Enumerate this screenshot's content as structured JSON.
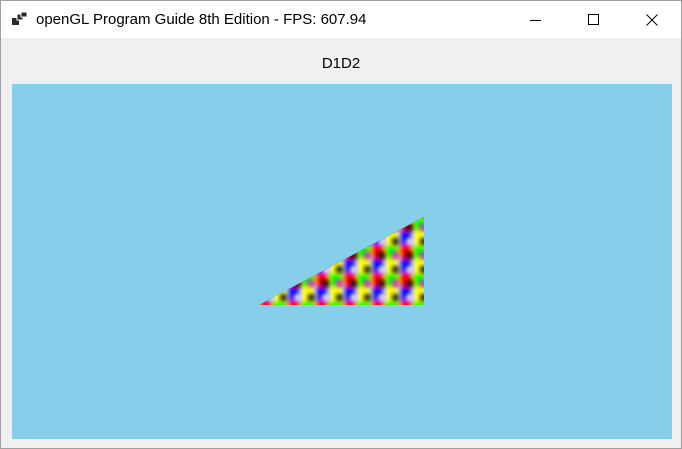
{
  "window": {
    "title": "openGL Program Guide 8th Edition - FPS: 607.94",
    "icon": "app-windows-icon",
    "controls": {
      "minimize_icon": "minimize-icon",
      "maximize_icon": "maximize-icon",
      "close_icon": "close-icon"
    }
  },
  "client": {
    "label": "D1D2"
  },
  "viewport": {
    "background_color": "#87ceeb",
    "shape": "textured-triangle",
    "texture_colors": [
      "#ff0000",
      "#ffff00",
      "#00ff00",
      "#0000ff",
      "#ff00ff",
      "#000000",
      "#ffffff"
    ]
  }
}
